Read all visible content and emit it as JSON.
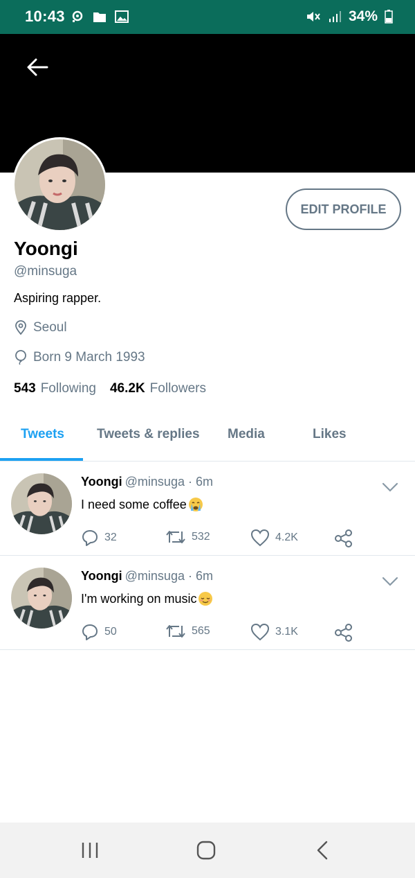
{
  "status_bar": {
    "time": "10:43",
    "battery": "34%",
    "icons": [
      "notification-icon",
      "folder-icon",
      "image-icon",
      "mute-icon",
      "signal-icon",
      "battery-icon"
    ],
    "background": "#0b6d5b"
  },
  "header": {
    "back_icon": "arrow-left-icon",
    "banner_color": "#000000"
  },
  "profile": {
    "name": "Yoongi",
    "handle": "@minsuga",
    "bio": "Aspiring rapper.",
    "location": "Seoul",
    "born": "Born 9 March 1993",
    "following_count": "543",
    "following_label": "Following",
    "followers_count": "46.2K",
    "followers_label": "Followers",
    "edit_button": "EDIT PROFILE"
  },
  "tabs": [
    {
      "label": "Tweets",
      "active": true
    },
    {
      "label": "Tweets & replies",
      "active": false
    },
    {
      "label": "Media",
      "active": false
    },
    {
      "label": "Likes",
      "active": false
    }
  ],
  "tweets": [
    {
      "name": "Yoongi",
      "handle_time": "@minsuga · 6m",
      "text": "I need some coffee",
      "emoji": "crying-face",
      "replies": "32",
      "retweets": "532",
      "likes": "4.2K"
    },
    {
      "name": "Yoongi",
      "handle_time": "@minsuga · 6m",
      "text": "I'm working on music",
      "emoji": "relieved-face",
      "replies": "50",
      "retweets": "565",
      "likes": "3.1K"
    }
  ],
  "colors": {
    "accent": "#1da1f2",
    "secondary_text": "#657786",
    "divider": "#e1e8ed"
  },
  "nav_bar": {
    "icons": [
      "recents-icon",
      "home-icon",
      "back-icon"
    ]
  }
}
